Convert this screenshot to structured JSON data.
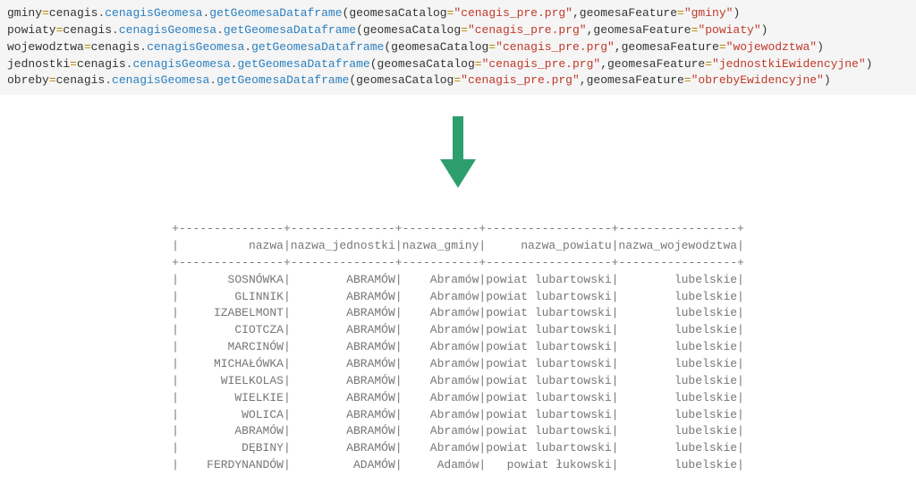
{
  "code": {
    "lines": [
      {
        "var": "gminy",
        "obj": "cenagis",
        "mod": "cenagisGeomesa",
        "fn": "getGeomesaDataframe",
        "kw1": "geomesaCatalog",
        "val1": "\"cenagis_pre.prg\"",
        "kw2": "geomesaFeature",
        "val2": "\"gminy\""
      },
      {
        "var": "powiaty",
        "obj": "cenagis",
        "mod": "cenagisGeomesa",
        "fn": "getGeomesaDataframe",
        "kw1": "geomesaCatalog",
        "val1": "\"cenagis_pre.prg\"",
        "kw2": "geomesaFeature",
        "val2": "\"powiaty\""
      },
      {
        "var": "wojewodztwa",
        "obj": "cenagis",
        "mod": "cenagisGeomesa",
        "fn": "getGeomesaDataframe",
        "kw1": "geomesaCatalog",
        "val1": "\"cenagis_pre.prg\"",
        "kw2": "geomesaFeature",
        "val2": "\"wojewodztwa\""
      },
      {
        "var": "jednostki",
        "obj": "cenagis",
        "mod": "cenagisGeomesa",
        "fn": "getGeomesaDataframe",
        "kw1": "geomesaCatalog",
        "val1": "\"cenagis_pre.prg\"",
        "kw2": "geomesaFeature",
        "val2": "\"jednostkiEwidencyjne\""
      },
      {
        "var": "obreby",
        "obj": "cenagis",
        "mod": "cenagisGeomesa",
        "fn": "getGeomesaDataframe",
        "kw1": "geomesaCatalog",
        "val1": "\"cenagis_pre.prg\"",
        "kw2": "geomesaFeature",
        "val2": "\"obrebyEwidencyjne\""
      }
    ]
  },
  "arrow": {
    "color": "#2e9e6f"
  },
  "table": {
    "widths": [
      15,
      15,
      11,
      18,
      17
    ],
    "headers": [
      "nazwa",
      "nazwa_jednostki",
      "nazwa_gminy",
      "nazwa_powiatu",
      "nazwa_wojewodztwa"
    ],
    "rows": [
      [
        "SOSNÓWKA",
        "ABRAMÓW",
        "Abramów",
        "powiat lubartowski",
        "lubelskie"
      ],
      [
        "GLINNIK",
        "ABRAMÓW",
        "Abramów",
        "powiat lubartowski",
        "lubelskie"
      ],
      [
        "IZABELMONT",
        "ABRAMÓW",
        "Abramów",
        "powiat lubartowski",
        "lubelskie"
      ],
      [
        "CIOTCZA",
        "ABRAMÓW",
        "Abramów",
        "powiat lubartowski",
        "lubelskie"
      ],
      [
        "MARCINÓW",
        "ABRAMÓW",
        "Abramów",
        "powiat lubartowski",
        "lubelskie"
      ],
      [
        "MICHAŁÓWKA",
        "ABRAMÓW",
        "Abramów",
        "powiat lubartowski",
        "lubelskie"
      ],
      [
        "WIELKOLAS",
        "ABRAMÓW",
        "Abramów",
        "powiat lubartowski",
        "lubelskie"
      ],
      [
        "WIELKIE",
        "ABRAMÓW",
        "Abramów",
        "powiat lubartowski",
        "lubelskie"
      ],
      [
        "WOLICA",
        "ABRAMÓW",
        "Abramów",
        "powiat lubartowski",
        "lubelskie"
      ],
      [
        "ABRAMÓW",
        "ABRAMÓW",
        "Abramów",
        "powiat lubartowski",
        "lubelskie"
      ],
      [
        "DĘBINY",
        "ABRAMÓW",
        "Abramów",
        "powiat lubartowski",
        "lubelskie"
      ],
      [
        "FERDYNANDÓW",
        "ADAMÓW",
        "Adamów",
        "powiat łukowski",
        "lubelskie"
      ]
    ]
  }
}
